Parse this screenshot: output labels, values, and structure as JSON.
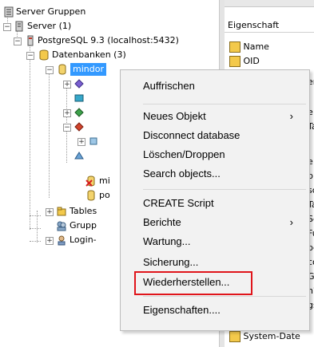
{
  "tree": {
    "root": "Server Gruppen",
    "servers": "Server (1)",
    "postgres": "PostgreSQL 9.3 (localhost:5432)",
    "databases": "Datenbanken (3)",
    "selected_db": "mindor",
    "db2": "mi",
    "db3": "po",
    "tables": "Tables",
    "groups": "Grupp",
    "logins": "Login-"
  },
  "properties_panel": {
    "header": "Eigenschaft",
    "rows": [
      "Name",
      "OID"
    ],
    "fragments": [
      "er",
      "e",
      "Tal",
      "e",
      "p",
      "sche",
      "Tab",
      "Sec",
      "Fun",
      "pe",
      "con",
      "Ger",
      "n?",
      "gsl"
    ],
    "bottom": "System-Date"
  },
  "context_menu": {
    "items": [
      {
        "label": "Auffrischen"
      },
      {
        "label": "Neues Objekt",
        "submenu_arrow": "›"
      },
      {
        "label": "Disconnect database"
      },
      {
        "label": "Löschen/Droppen"
      },
      {
        "label": "Search objects..."
      },
      {
        "label": "CREATE Script"
      },
      {
        "label": "Berichte",
        "submenu_arrow": "›"
      },
      {
        "label": "Wartung..."
      },
      {
        "label": "Sicherung..."
      },
      {
        "label": "Wiederherstellen..."
      },
      {
        "label": "Eigenschaften...."
      }
    ],
    "highlighted_item": "Wiederherstellen...",
    "highlight_color": "#e0151b"
  },
  "colors": {
    "selection": "#3399ff",
    "menu_bg": "#f2f2f2"
  }
}
